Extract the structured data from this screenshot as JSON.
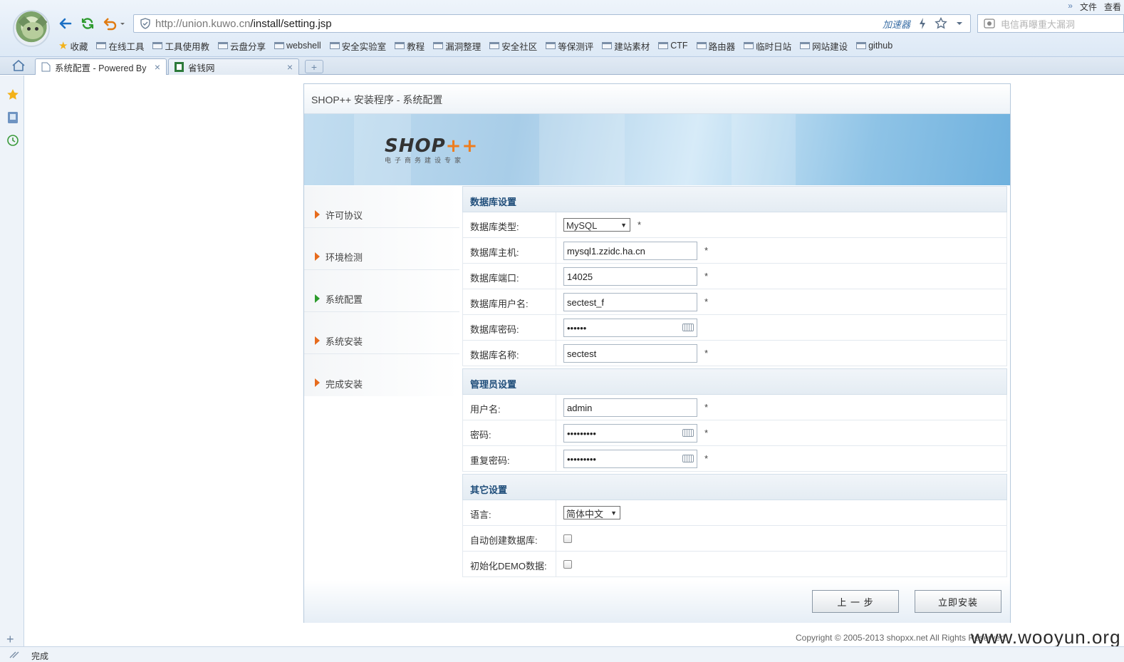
{
  "browser": {
    "url_host": "http://union.kuwo.cn",
    "url_path": "/install/setting.jsp",
    "accelerator_label": "加速器",
    "search_placeholder": "电信再曝重大漏洞",
    "top_menu": [
      "»",
      "文件",
      "查看"
    ],
    "bookmarks": [
      "收藏",
      "在线工具",
      "工具使用教",
      "云盘分享",
      "webshell",
      "安全实验室",
      "教程",
      "漏洞整理",
      "安全社区",
      "等保测评",
      "建站素材",
      "CTF",
      "路由器",
      "临时日站",
      "网站建设",
      "github"
    ],
    "tabs": [
      {
        "label": "系统配置 - Powered By",
        "close": "×"
      },
      {
        "label": "省钱网",
        "close": "×"
      }
    ],
    "new_tab": "+",
    "status_text": "完成"
  },
  "installer": {
    "title": "SHOP++ 安装程序 - 系统配置",
    "logo_main": "SHOP",
    "logo_plus": "++",
    "logo_sub": "电子商务建设专家",
    "steps": [
      "许可协议",
      "环境检测",
      "系统配置",
      "系统安装",
      "完成安装"
    ],
    "active_step": 2,
    "sections": {
      "db": {
        "heading": "数据库设置",
        "type_label": "数据库类型:",
        "type_value": "MySQL",
        "host_label": "数据库主机:",
        "host_value": "mysql1.zzidc.ha.cn",
        "port_label": "数据库端口:",
        "port_value": "14025",
        "user_label": "数据库用户名:",
        "user_value": "sectest_f",
        "pass_label": "数据库密码:",
        "pass_value": "••••••",
        "name_label": "数据库名称:",
        "name_value": "sectest"
      },
      "admin": {
        "heading": "管理员设置",
        "user_label": "用户名:",
        "user_value": "admin",
        "pass_label": "密码:",
        "pass_value": "•••••••••",
        "repass_label": "重复密码:",
        "repass_value": "•••••••••"
      },
      "other": {
        "heading": "其它设置",
        "lang_label": "语言:",
        "lang_value": "简体中文",
        "autodb_label": "自动创建数据库:",
        "demo_label": "初始化DEMO数据:"
      }
    },
    "required_mark": "*",
    "prev_button": "上 一 步",
    "install_button": "立即安装"
  },
  "footer": {
    "copyright": "Copyright © 2005-2013 shopxx.net All Rights Reserved.",
    "watermark": "www.wooyun.org"
  },
  "colors": {
    "step_arrow": "#e66b1d",
    "step_arrow_active": "#2c9b2c",
    "section_heading": "#1f4d7a",
    "logo_plus": "#ee7d1e"
  }
}
